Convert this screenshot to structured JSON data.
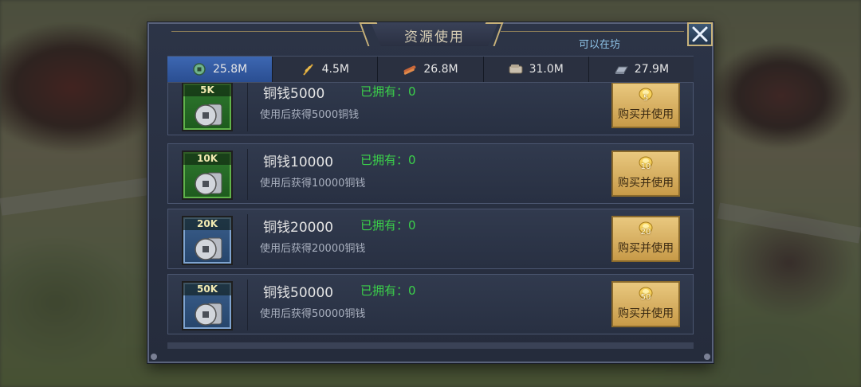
{
  "dialog": {
    "title": "资源使用",
    "hint": "可以在坊"
  },
  "tabs": [
    {
      "value": "25.8M",
      "icon": "copper-coin-icon",
      "active": true
    },
    {
      "value": "4.5M",
      "icon": "grain-icon",
      "active": false
    },
    {
      "value": "26.8M",
      "icon": "wood-icon",
      "active": false
    },
    {
      "value": "31.0M",
      "icon": "stone-icon",
      "active": false
    },
    {
      "value": "27.9M",
      "icon": "iron-icon",
      "active": false
    }
  ],
  "items": [
    {
      "badge": "5K",
      "name": "铜钱5000",
      "owned": "已拥有：0",
      "desc": "使用后获得5000铜钱",
      "cost": "5",
      "buy_label": "购买并使用",
      "frame": "green"
    },
    {
      "badge": "10K",
      "name": "铜钱10000",
      "owned": "已拥有：0",
      "desc": "使用后获得10000铜钱",
      "cost": "10",
      "buy_label": "购买并使用",
      "frame": "green"
    },
    {
      "badge": "20K",
      "name": "铜钱20000",
      "owned": "已拥有：0",
      "desc": "使用后获得20000铜钱",
      "cost": "20",
      "buy_label": "购买并使用",
      "frame": "blue"
    },
    {
      "badge": "50K",
      "name": "铜钱50000",
      "owned": "已拥有：0",
      "desc": "使用后获得50000铜钱",
      "cost": "50",
      "buy_label": "购买并使用",
      "frame": "blue"
    }
  ],
  "colors": {
    "active_tab": "#3d67b2",
    "owned_text": "#3bd14a",
    "hint_text": "#8fc4e8",
    "button_gold": "#e9c87f"
  }
}
